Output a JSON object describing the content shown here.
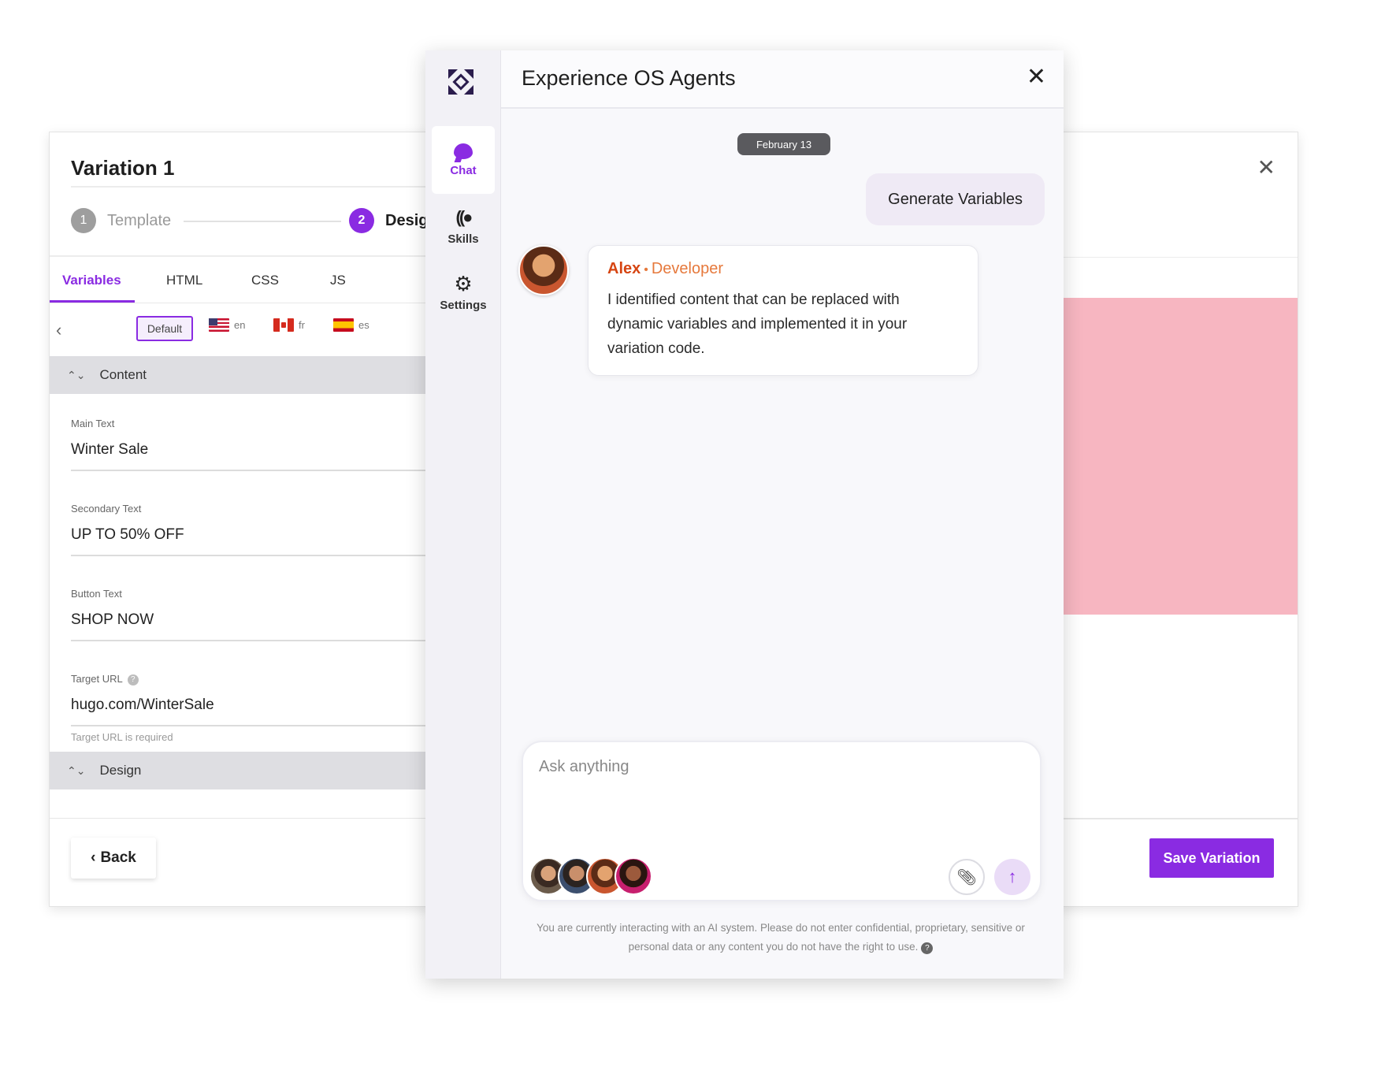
{
  "variation_panel": {
    "title": "Variation 1",
    "steps": [
      {
        "num": "1",
        "label": "Template"
      },
      {
        "num": "2",
        "label": "Design"
      }
    ],
    "tabs": [
      "Variables",
      "HTML",
      "CSS",
      "JS"
    ],
    "locales": {
      "default": "Default",
      "en": "en",
      "fr": "fr",
      "es": "es"
    },
    "content_section": "Content",
    "fields": [
      {
        "label": "Main Text",
        "value": "Winter Sale"
      },
      {
        "label": "Secondary Text",
        "value": "UP TO 50% OFF"
      },
      {
        "label": "Button Text",
        "value": "SHOP NOW"
      },
      {
        "label": "Target URL",
        "value": "hugo.com/WinterSale",
        "hint": "Target URL is required"
      }
    ],
    "design_section": "Design",
    "back_label": "Back"
  },
  "preview_panel": {
    "save_label": "Save Variation",
    "banner_color": "#f7b6c1"
  },
  "chat": {
    "title": "Experience OS Agents",
    "rail": [
      {
        "label": "Chat",
        "icon": "chat-bubble-icon"
      },
      {
        "label": "Skills",
        "icon": "skills-icon"
      },
      {
        "label": "Settings",
        "icon": "gear-icon"
      }
    ],
    "date": "February 13",
    "user_message": "Generate Variables",
    "agent": {
      "name": "Alex",
      "role": "Developer",
      "message": "I identified content that can be replaced with dynamic variables and implemented it in your variation code."
    },
    "input_placeholder": "Ask anything",
    "disclaimer": "You are currently interacting with an AI system. Please do not enter confidential, proprietary, sensitive or personal data or any content you do not have the right to use."
  },
  "colors": {
    "accent": "#8a2be2",
    "agent_name": "#d64512"
  }
}
